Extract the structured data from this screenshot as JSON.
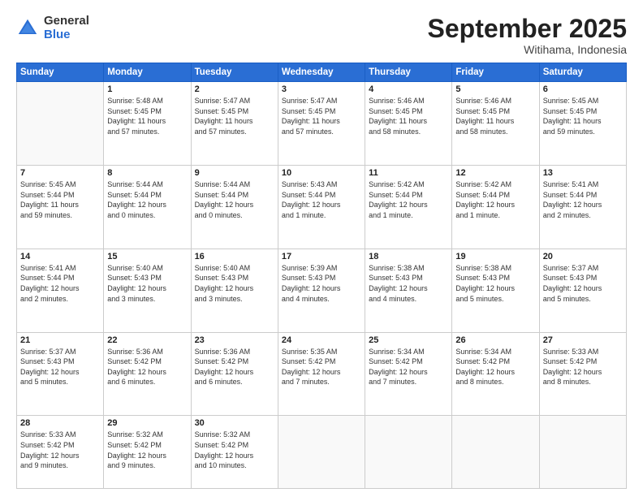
{
  "header": {
    "logo_general": "General",
    "logo_blue": "Blue",
    "month_title": "September 2025",
    "subtitle": "Witihama, Indonesia"
  },
  "weekdays": [
    "Sunday",
    "Monday",
    "Tuesday",
    "Wednesday",
    "Thursday",
    "Friday",
    "Saturday"
  ],
  "days": [
    {
      "num": "",
      "info": ""
    },
    {
      "num": "1",
      "info": "Sunrise: 5:48 AM\nSunset: 5:45 PM\nDaylight: 11 hours\nand 57 minutes."
    },
    {
      "num": "2",
      "info": "Sunrise: 5:47 AM\nSunset: 5:45 PM\nDaylight: 11 hours\nand 57 minutes."
    },
    {
      "num": "3",
      "info": "Sunrise: 5:47 AM\nSunset: 5:45 PM\nDaylight: 11 hours\nand 57 minutes."
    },
    {
      "num": "4",
      "info": "Sunrise: 5:46 AM\nSunset: 5:45 PM\nDaylight: 11 hours\nand 58 minutes."
    },
    {
      "num": "5",
      "info": "Sunrise: 5:46 AM\nSunset: 5:45 PM\nDaylight: 11 hours\nand 58 minutes."
    },
    {
      "num": "6",
      "info": "Sunrise: 5:45 AM\nSunset: 5:45 PM\nDaylight: 11 hours\nand 59 minutes."
    },
    {
      "num": "7",
      "info": "Sunrise: 5:45 AM\nSunset: 5:44 PM\nDaylight: 11 hours\nand 59 minutes."
    },
    {
      "num": "8",
      "info": "Sunrise: 5:44 AM\nSunset: 5:44 PM\nDaylight: 12 hours\nand 0 minutes."
    },
    {
      "num": "9",
      "info": "Sunrise: 5:44 AM\nSunset: 5:44 PM\nDaylight: 12 hours\nand 0 minutes."
    },
    {
      "num": "10",
      "info": "Sunrise: 5:43 AM\nSunset: 5:44 PM\nDaylight: 12 hours\nand 1 minute."
    },
    {
      "num": "11",
      "info": "Sunrise: 5:42 AM\nSunset: 5:44 PM\nDaylight: 12 hours\nand 1 minute."
    },
    {
      "num": "12",
      "info": "Sunrise: 5:42 AM\nSunset: 5:44 PM\nDaylight: 12 hours\nand 1 minute."
    },
    {
      "num": "13",
      "info": "Sunrise: 5:41 AM\nSunset: 5:44 PM\nDaylight: 12 hours\nand 2 minutes."
    },
    {
      "num": "14",
      "info": "Sunrise: 5:41 AM\nSunset: 5:44 PM\nDaylight: 12 hours\nand 2 minutes."
    },
    {
      "num": "15",
      "info": "Sunrise: 5:40 AM\nSunset: 5:43 PM\nDaylight: 12 hours\nand 3 minutes."
    },
    {
      "num": "16",
      "info": "Sunrise: 5:40 AM\nSunset: 5:43 PM\nDaylight: 12 hours\nand 3 minutes."
    },
    {
      "num": "17",
      "info": "Sunrise: 5:39 AM\nSunset: 5:43 PM\nDaylight: 12 hours\nand 4 minutes."
    },
    {
      "num": "18",
      "info": "Sunrise: 5:38 AM\nSunset: 5:43 PM\nDaylight: 12 hours\nand 4 minutes."
    },
    {
      "num": "19",
      "info": "Sunrise: 5:38 AM\nSunset: 5:43 PM\nDaylight: 12 hours\nand 5 minutes."
    },
    {
      "num": "20",
      "info": "Sunrise: 5:37 AM\nSunset: 5:43 PM\nDaylight: 12 hours\nand 5 minutes."
    },
    {
      "num": "21",
      "info": "Sunrise: 5:37 AM\nSunset: 5:43 PM\nDaylight: 12 hours\nand 5 minutes."
    },
    {
      "num": "22",
      "info": "Sunrise: 5:36 AM\nSunset: 5:42 PM\nDaylight: 12 hours\nand 6 minutes."
    },
    {
      "num": "23",
      "info": "Sunrise: 5:36 AM\nSunset: 5:42 PM\nDaylight: 12 hours\nand 6 minutes."
    },
    {
      "num": "24",
      "info": "Sunrise: 5:35 AM\nSunset: 5:42 PM\nDaylight: 12 hours\nand 7 minutes."
    },
    {
      "num": "25",
      "info": "Sunrise: 5:34 AM\nSunset: 5:42 PM\nDaylight: 12 hours\nand 7 minutes."
    },
    {
      "num": "26",
      "info": "Sunrise: 5:34 AM\nSunset: 5:42 PM\nDaylight: 12 hours\nand 8 minutes."
    },
    {
      "num": "27",
      "info": "Sunrise: 5:33 AM\nSunset: 5:42 PM\nDaylight: 12 hours\nand 8 minutes."
    },
    {
      "num": "28",
      "info": "Sunrise: 5:33 AM\nSunset: 5:42 PM\nDaylight: 12 hours\nand 9 minutes."
    },
    {
      "num": "29",
      "info": "Sunrise: 5:32 AM\nSunset: 5:42 PM\nDaylight: 12 hours\nand 9 minutes."
    },
    {
      "num": "30",
      "info": "Sunrise: 5:32 AM\nSunset: 5:42 PM\nDaylight: 12 hours\nand 10 minutes."
    },
    {
      "num": "",
      "info": ""
    },
    {
      "num": "",
      "info": ""
    },
    {
      "num": "",
      "info": ""
    },
    {
      "num": "",
      "info": ""
    }
  ]
}
